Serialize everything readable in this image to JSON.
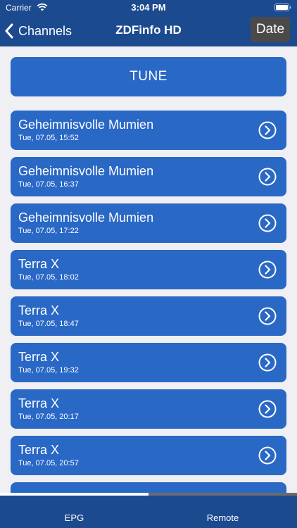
{
  "status_bar": {
    "carrier": "Carrier",
    "time": "3:04 PM"
  },
  "nav": {
    "back_label": "Channels",
    "title": "ZDFinfo HD",
    "date_label": "Date"
  },
  "tune_label": "TUNE",
  "programs": [
    {
      "title": "Geheimnisvolle Mumien",
      "time": "Tue, 07.05, 15:52"
    },
    {
      "title": "Geheimnisvolle Mumien",
      "time": "Tue, 07.05, 16:37"
    },
    {
      "title": "Geheimnisvolle Mumien",
      "time": "Tue, 07.05, 17:22"
    },
    {
      "title": "Terra X",
      "time": "Tue, 07.05, 18:02"
    },
    {
      "title": "Terra X",
      "time": "Tue, 07.05, 18:47"
    },
    {
      "title": "Terra X",
      "time": "Tue, 07.05, 19:32"
    },
    {
      "title": "Terra X",
      "time": "Tue, 07.05, 20:17"
    },
    {
      "title": "Terra X",
      "time": "Tue, 07.05, 20:57"
    },
    {
      "title": "",
      "time": ""
    }
  ],
  "page_indicator_fraction": 0.5,
  "tabs": [
    {
      "label": "EPG"
    },
    {
      "label": "Remote"
    }
  ],
  "colors": {
    "bar_blue": "#1c4a8f",
    "button_blue": "#2a68c6",
    "background": "#efeff4",
    "date_button": "#4a4a4a"
  }
}
